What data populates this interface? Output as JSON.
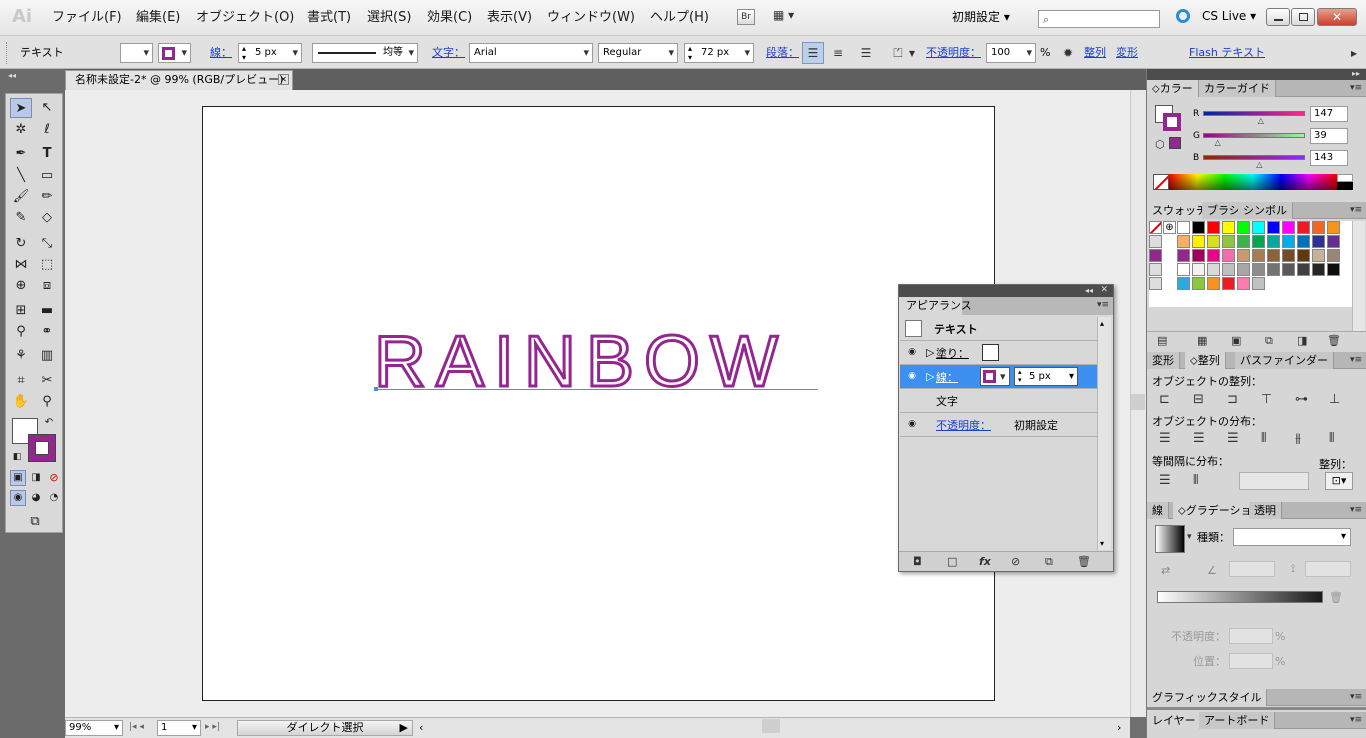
{
  "app": {
    "logo": "Ai",
    "menus": [
      "ファイル(F)",
      "編集(E)",
      "オブジェクト(O)",
      "書式(T)",
      "選択(S)",
      "効果(C)",
      "表示(V)",
      "ウィンドウ(W)",
      "ヘルプ(H)"
    ],
    "bridge_label": "Br",
    "workspace": "初期設定",
    "cs_live": "CS Live"
  },
  "control_bar": {
    "object_type": "テキスト",
    "stroke_link": "線：",
    "stroke_weight": "5 px",
    "stroke_profile": "均等",
    "char_link": "文字：",
    "font_family": "Arial",
    "font_style": "Regular",
    "font_size": "72 px",
    "paragraph_link": "段落：",
    "opacity_link": "不透明度：",
    "opacity_value": "100",
    "opacity_unit": "%",
    "align_link": "整列",
    "transform_link": "変形",
    "flash_link": "Flash テキスト",
    "colors": {
      "fill": "#ffffff",
      "stroke": "#93278f"
    }
  },
  "document": {
    "tab_title": "名称未設定-2* @ 99% (RGB/プレビュー)",
    "art_text": "RAINBOW",
    "zoom": "99%",
    "artboard_num": "1",
    "status_tool": "ダイレクト選択"
  },
  "appearance_panel": {
    "tab": "アピアランス",
    "header_label": "テキスト",
    "fill_label": "塗り：",
    "stroke_label": "線：",
    "stroke_weight": "5 px",
    "char_label": "文字",
    "opacity_label": "不透明度：",
    "opacity_value": "初期設定"
  },
  "color_panel": {
    "tabs": [
      "カラー",
      "カラーガイド"
    ],
    "r_label": "R",
    "g_label": "G",
    "b_label": "B",
    "r": "147",
    "g": "39",
    "b": "143",
    "r_fraction": 0.576,
    "g_fraction": 0.153,
    "b_fraction": 0.561,
    "current_color": "#93278f"
  },
  "swatches_panel": {
    "tabs": [
      "スウォッチ",
      "ブラシ",
      "シンボル"
    ],
    "rows": [
      [
        "#ffffff",
        "#000000",
        "#ff0000",
        "#ffff00",
        "#00ff00",
        "#00ffff",
        "#0000ff",
        "#ff00ff",
        "#ed1c24",
        "#f26522",
        "#f7941d"
      ],
      [
        "#fbaf5d",
        "#fff200",
        "#d7df23",
        "#8dc63f",
        "#39b54a",
        "#00a651",
        "#00a99d",
        "#00aeef",
        "#0072bc",
        "#2e3192",
        "#662d91"
      ],
      [
        "#93278f",
        "#9e005d",
        "#ec008c",
        "#f06eaa",
        "#c69c6d",
        "#a67c52",
        "#8c6239",
        "#754c24",
        "#603913",
        "#c7b299",
        "#998675"
      ],
      [
        "#ffffff",
        "#f2f2f2",
        "#d9d9d9",
        "#bfbfbf",
        "#a6a6a6",
        "#8c8c8c",
        "#737373",
        "#595959",
        "#404040",
        "#262626",
        "#0d0d0d"
      ],
      [
        "#29abe2",
        "#8cc63f",
        "#f7931e",
        "#ed1c24",
        "#ff7bac",
        "#c1c1c1"
      ]
    ]
  },
  "align_panel": {
    "tabs": [
      "変形",
      "整列",
      "パスファインダー"
    ],
    "align_objects": "オブジェクトの整列：",
    "distribute_objects": "オブジェクトの分布：",
    "distribute_spacing": "等間隔に分布：",
    "align_to": "整列："
  },
  "gradient_panel": {
    "tabs": [
      "線",
      "グラデーション",
      "透明"
    ],
    "type_label": "種類：",
    "opacity_label": "不透明度：",
    "location_label": "位置："
  },
  "graphic_styles": {
    "tab": "グラフィックスタイル"
  },
  "layers_panel": {
    "tabs": [
      "レイヤー",
      "アートボード"
    ]
  }
}
